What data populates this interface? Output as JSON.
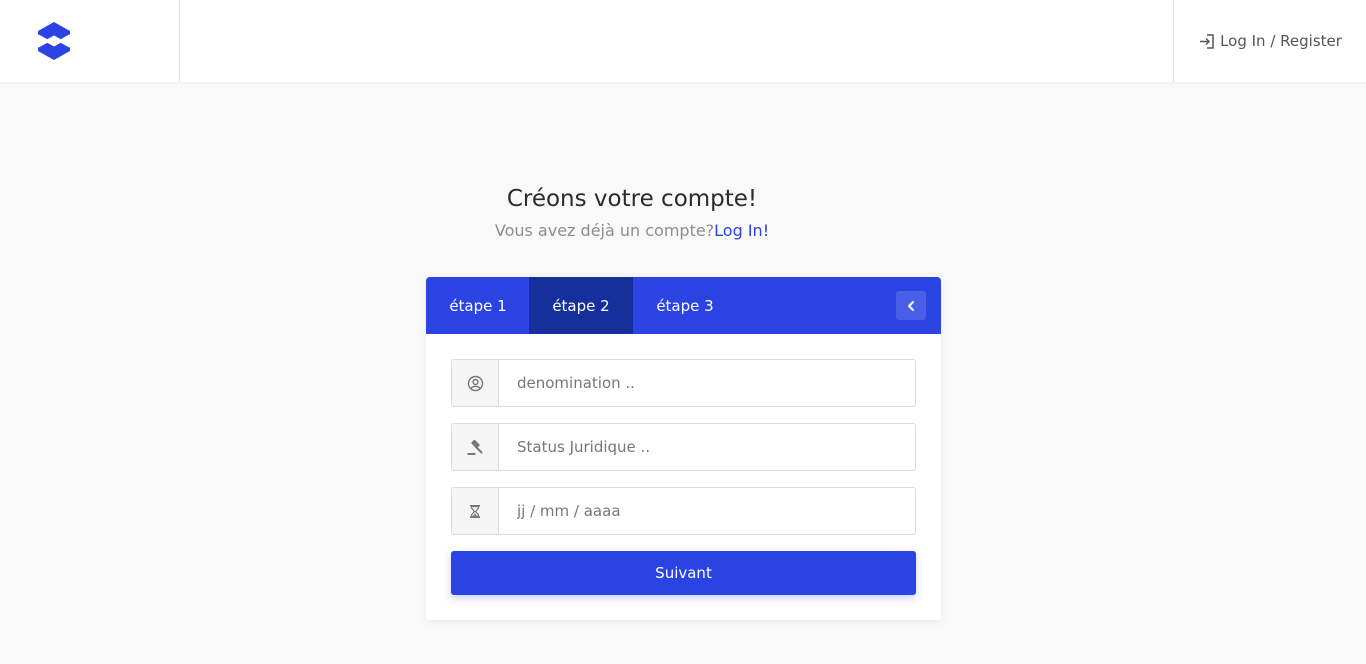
{
  "header": {
    "logo_icon": "brand-logo",
    "login_icon": "sign-in-icon",
    "login_label": "Log In / Register"
  },
  "intro": {
    "title": "Créons votre compte!",
    "subtitle": "Vous avez déjà un compte?",
    "login_link": "Log In!"
  },
  "tabs": [
    {
      "label": "étape 1",
      "active": false
    },
    {
      "label": "étape 2",
      "active": true
    },
    {
      "label": "étape 3",
      "active": false
    }
  ],
  "collapse_icon": "chevron-left-icon",
  "form": {
    "denomination": {
      "icon": "user-circle-icon",
      "placeholder": "denomination .."
    },
    "status": {
      "icon": "gavel-icon",
      "placeholder": "Status Juridique .."
    },
    "date": {
      "icon": "hourglass-icon",
      "placeholder": "jj / mm / aaaa"
    },
    "submit_label": "Suivant"
  },
  "colors": {
    "primary": "#2b43e3",
    "tab_active": "#15309a",
    "background": "#f9f9f9"
  }
}
